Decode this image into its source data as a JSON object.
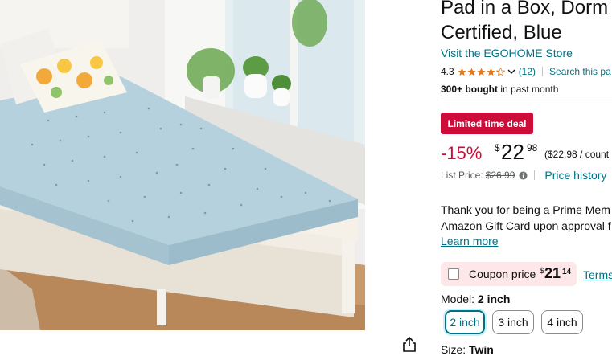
{
  "product": {
    "title_line1": "Pad in a Box, Dorm",
    "title_line2": "Certified, Blue",
    "store_link": "Visit the EGOHOME Store",
    "rating": "4.3",
    "rating_count": "(12)",
    "search_link": "Search this pa",
    "bought_bold": "300+ bought",
    "bought_rest": " in past month",
    "stars": {
      "full": 4,
      "partial": 0.3,
      "color": "#de7921"
    }
  },
  "deal": {
    "badge": "Limited time deal",
    "badge_color": "#cc0c39",
    "discount": "-15%",
    "currency": "$",
    "price_whole": "22",
    "price_fraction": "98",
    "unit_price": "($22.98 / count",
    "list_price_label": "List Price:",
    "list_price_value": "$26.99",
    "price_history": "Price history"
  },
  "prime": {
    "line1": "Thank you for being a Prime Mem",
    "line2": "Amazon Gift Card upon approval f",
    "learn_more": "Learn more"
  },
  "coupon": {
    "label": "Coupon price",
    "currency": "$",
    "whole": "21",
    "fraction": "14",
    "terms": "Terms"
  },
  "model": {
    "label": "Model:",
    "selected": "2 inch",
    "options": [
      "2 inch",
      "3 inch",
      "4 inch"
    ]
  },
  "size": {
    "label": "Size:",
    "selected": "Twin"
  },
  "icons": {
    "share": "share-icon",
    "info": "info-icon",
    "chevron": "chevron-down-icon"
  }
}
